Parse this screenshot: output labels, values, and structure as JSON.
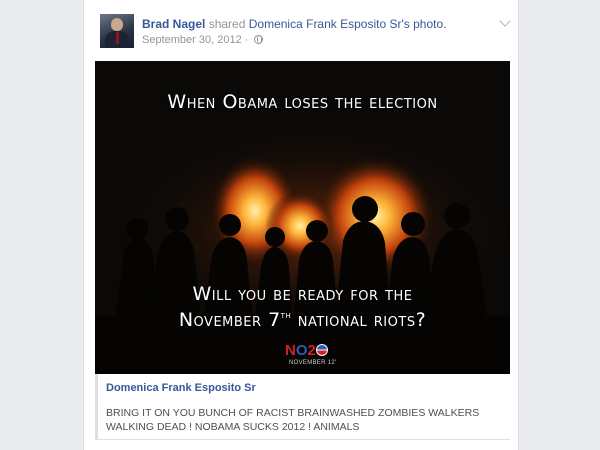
{
  "post": {
    "author_name": "Brad Nagel",
    "action_text": "shared",
    "source_link": "Domenica Frank Esposito Sr's photo.",
    "date": "September 30, 2012",
    "privacy_icon": "globe-icon",
    "menu_icon": "chevron-down-icon"
  },
  "image": {
    "top_text": "When Obama loses the election",
    "bottom_text_line1": "Will you be ready for the",
    "bottom_text_line2_pre": "November 7",
    "bottom_text_line2_sup": "th",
    "bottom_text_line2_post": " national riots?",
    "logo_n": "N",
    "logo_o": "O",
    "logo_2": "2",
    "logo_date": "NOVEMBER 12'"
  },
  "attachment": {
    "author": "Domenica Frank Esposito Sr",
    "caption": "BRING IT ON YOU BUNCH OF RACIST BRAINWASHED ZOMBIES WALKERS WALKING DEAD ! NOBAMA SUCKS 2012 ! ANIMALS"
  },
  "colors": {
    "link": "#365899",
    "meta": "#90949c",
    "fire": "#ff8a1e",
    "logo_red": "#d42020",
    "logo_blue": "#2b5cb8"
  }
}
